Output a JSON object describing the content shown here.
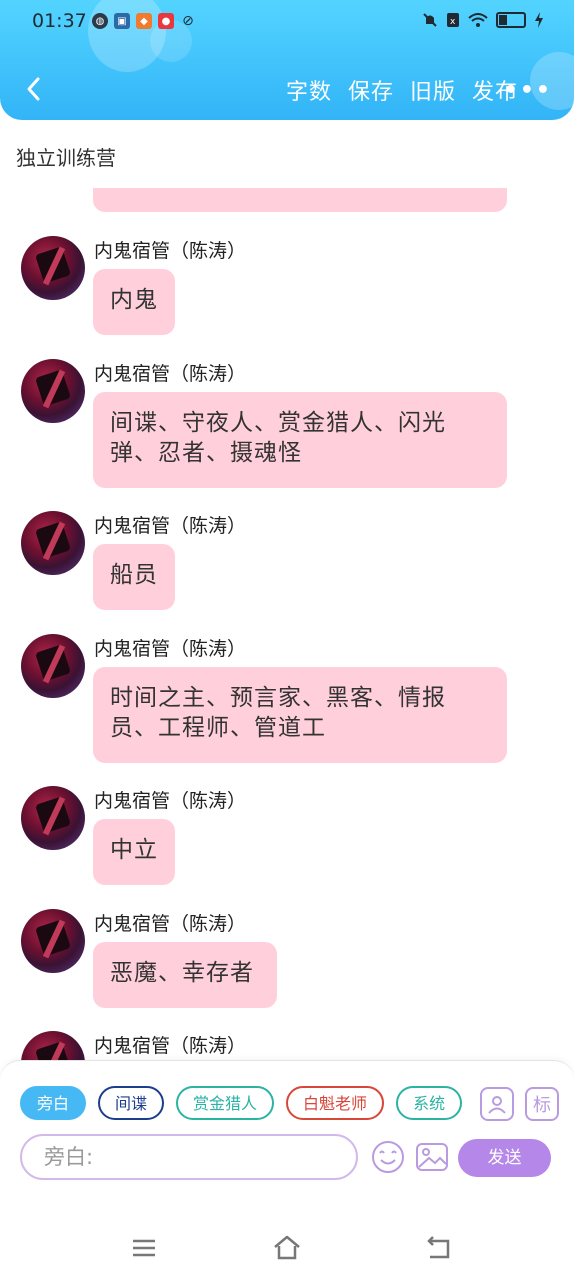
{
  "status": {
    "time": "01:37"
  },
  "nav": {
    "actions": [
      "字数",
      "保存",
      "旧版",
      "发布"
    ],
    "more": "•••"
  },
  "room_title": "独立训练营",
  "messages": [
    {
      "sender": "内鬼宿管（陈涛）",
      "text": "内鬼"
    },
    {
      "sender": "内鬼宿管（陈涛）",
      "text": "间谍、守夜人、赏金猎人、闪光弹、忍者、摄魂怪"
    },
    {
      "sender": "内鬼宿管（陈涛）",
      "text": "船员"
    },
    {
      "sender": "内鬼宿管（陈涛）",
      "text": "时间之主、预言家、黑客、情报员、工程师、管道工"
    },
    {
      "sender": "内鬼宿管（陈涛）",
      "text": "中立"
    },
    {
      "sender": "内鬼宿管（陈涛）",
      "text": "恶魔、幸存者"
    },
    {
      "sender": "内鬼宿管（陈涛）",
      "text": ""
    }
  ],
  "chips": [
    {
      "label": "旁白",
      "color": "#ffffff",
      "bg": "#46b9f4",
      "border": "#46b9f4"
    },
    {
      "label": "间谍",
      "color": "#1c3e8c",
      "bg": "#ffffff",
      "border": "#1c3e8c"
    },
    {
      "label": "赏金猎人",
      "color": "#2bb3a4",
      "bg": "#ffffff",
      "border": "#2bb3a4"
    },
    {
      "label": "白魁老师",
      "color": "#d9463a",
      "bg": "#ffffff",
      "border": "#d9463a"
    },
    {
      "label": "系统",
      "color": "#2bb3a4",
      "bg": "#ffffff",
      "border": "#2bb3a4"
    }
  ],
  "tools": {
    "tag_label": "标"
  },
  "input": {
    "placeholder": "旁白:"
  },
  "send_label": "发送"
}
